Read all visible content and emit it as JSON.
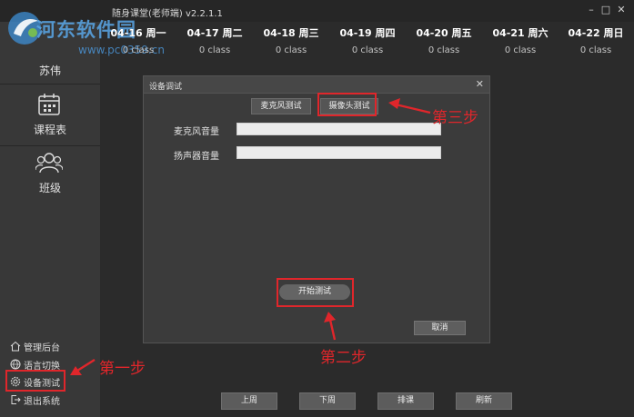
{
  "window": {
    "title": "随身课堂(老师端) v2.2.1.1",
    "minimize": "–",
    "maximize": "□",
    "close": "✕"
  },
  "watermark": {
    "text": "河东软件园",
    "url": "www.pc0359.cn"
  },
  "user": {
    "name": "苏伟"
  },
  "sidebar": {
    "nav": [
      {
        "label": "课程表",
        "icon": "calendar-icon"
      },
      {
        "label": "班级",
        "icon": "group-icon"
      }
    ],
    "links": [
      {
        "label": "管理后台",
        "icon": "home-icon"
      },
      {
        "label": "语言切换",
        "icon": "language-icon"
      },
      {
        "label": "设备测试",
        "icon": "gear-icon"
      },
      {
        "label": "退出系统",
        "icon": "exit-icon"
      }
    ]
  },
  "schedule": {
    "days": [
      {
        "label": "04-16 周一",
        "count": "0 class"
      },
      {
        "label": "04-17 周二",
        "count": "0 class"
      },
      {
        "label": "04-18 周三",
        "count": "0 class"
      },
      {
        "label": "04-19 周四",
        "count": "0 class"
      },
      {
        "label": "04-20 周五",
        "count": "0 class"
      },
      {
        "label": "04-21 周六",
        "count": "0 class"
      },
      {
        "label": "04-22 周日",
        "count": "0 class"
      }
    ]
  },
  "dialog": {
    "title": "设备调试",
    "close": "✕",
    "tabs": {
      "mic": "麦克风测试",
      "camera": "摄像头测试"
    },
    "fields": {
      "mic_volume": "麦克风音量",
      "speaker_volume": "扬声器音量"
    },
    "levels": {
      "mic": 0,
      "speaker": 0
    },
    "start_button": "开始测试",
    "cancel_button": "取消"
  },
  "bottom_nav": {
    "prev": "上周",
    "next": "下周",
    "schedule": "排课",
    "refresh": "刷新"
  },
  "annotations": {
    "step1": "第一步",
    "step2": "第二步",
    "step3": "第三步",
    "color": "#e0262b"
  }
}
